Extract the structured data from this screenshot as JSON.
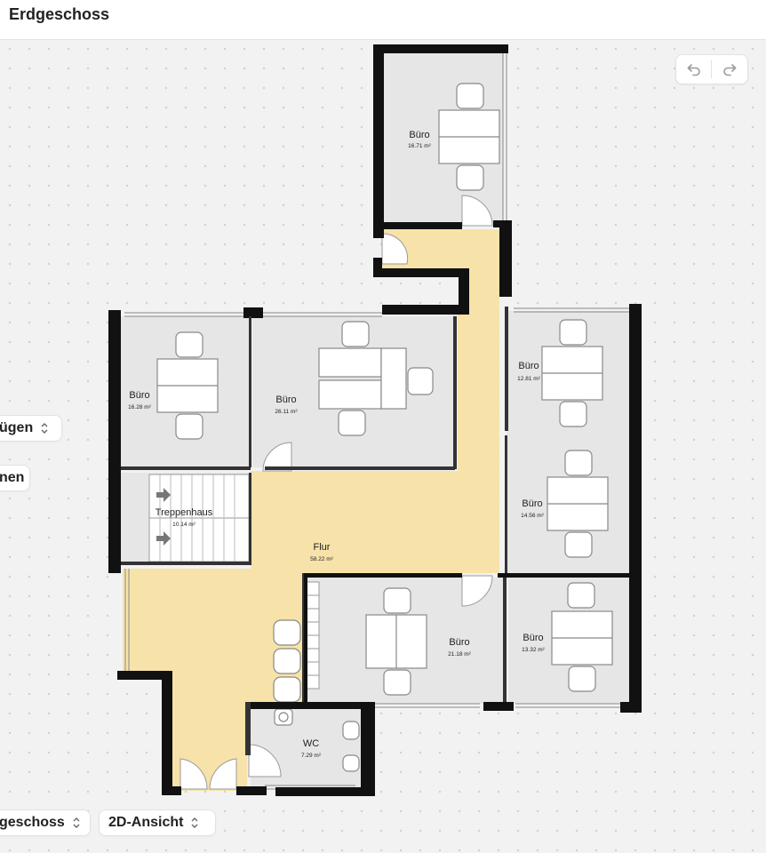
{
  "header": {
    "title": "Erdgeschoss"
  },
  "toolbar": {
    "undo_icon": "undo-icon",
    "redo_icon": "redo-icon"
  },
  "side_controls": {
    "insert_label": "Einfügen",
    "insert_visible": "ügen",
    "measure_label_visible": "nen"
  },
  "bottom_controls": {
    "floor_select": "Erdgeschoss",
    "floor_select_visible": "geschoss",
    "view_select": "2D-Ansicht"
  },
  "rooms": [
    {
      "id": "buero-top",
      "name": "Büro",
      "area": "16.71 m²"
    },
    {
      "id": "buero-left",
      "name": "Büro",
      "area": "16.28 m²"
    },
    {
      "id": "buero-mid",
      "name": "Büro",
      "area": "26.11 m²"
    },
    {
      "id": "buero-right-top",
      "name": "Büro",
      "area": "12.81 m²"
    },
    {
      "id": "buero-right-mid",
      "name": "Büro",
      "area": "14.56 m²"
    },
    {
      "id": "treppenhaus",
      "name": "Treppenhaus",
      "area": "10.14 m²"
    },
    {
      "id": "flur",
      "name": "Flur",
      "area": "58.22 m²"
    },
    {
      "id": "buero-bottom-mid",
      "name": "Büro",
      "area": "21.18 m²"
    },
    {
      "id": "buero-bottom-right",
      "name": "Büro",
      "area": "13.32 m²"
    },
    {
      "id": "wc",
      "name": "WC",
      "area": "7.29 m²"
    }
  ],
  "colors": {
    "corridor": "#f7e3a9",
    "room": "#e6e6e6",
    "wall": "#111111"
  }
}
